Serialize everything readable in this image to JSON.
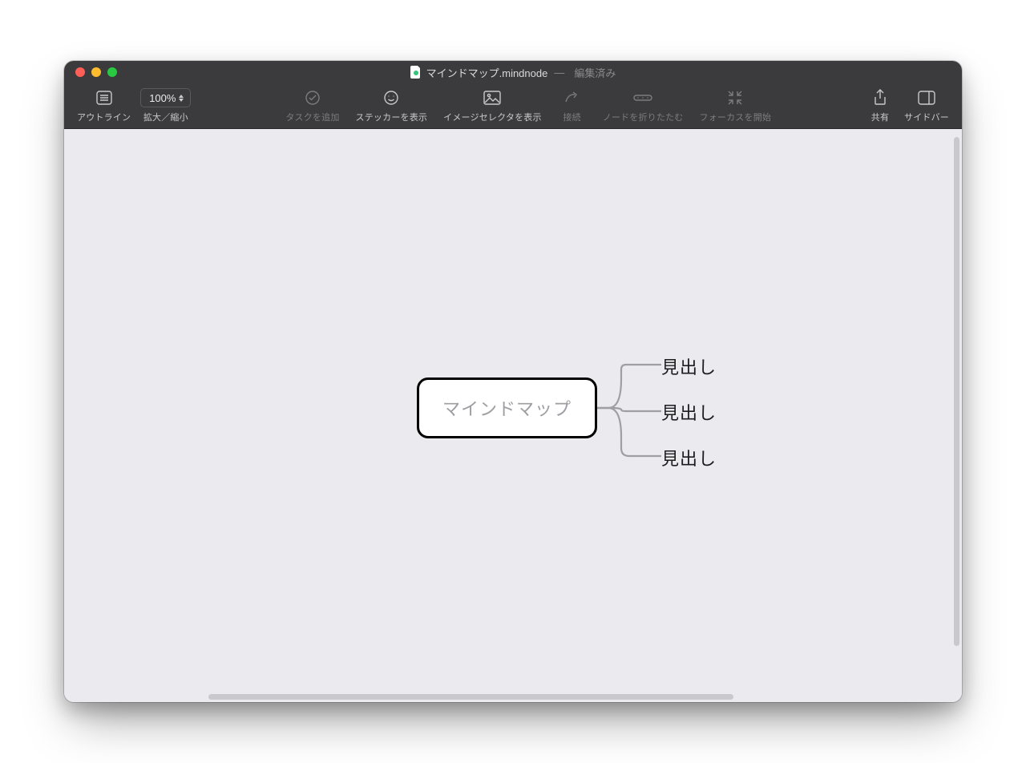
{
  "window": {
    "title": "マインドマップ.mindnode",
    "status": "編集済み"
  },
  "toolbar": {
    "outline": {
      "label": "アウトライン"
    },
    "zoom": {
      "value": "100%",
      "label": "拡大／縮小"
    },
    "addTask": {
      "label": "タスクを追加"
    },
    "stickers": {
      "label": "ステッカーを表示"
    },
    "images": {
      "label": "イメージセレクタを表示"
    },
    "connect": {
      "label": "接続"
    },
    "fold": {
      "label": "ノードを折りたたむ"
    },
    "focus": {
      "label": "フォーカスを開始"
    },
    "share": {
      "label": "共有"
    },
    "sidebar": {
      "label": "サイドバー"
    }
  },
  "mindmap": {
    "root": "マインドマップ",
    "children": [
      "見出し",
      "見出し",
      "見出し"
    ]
  }
}
